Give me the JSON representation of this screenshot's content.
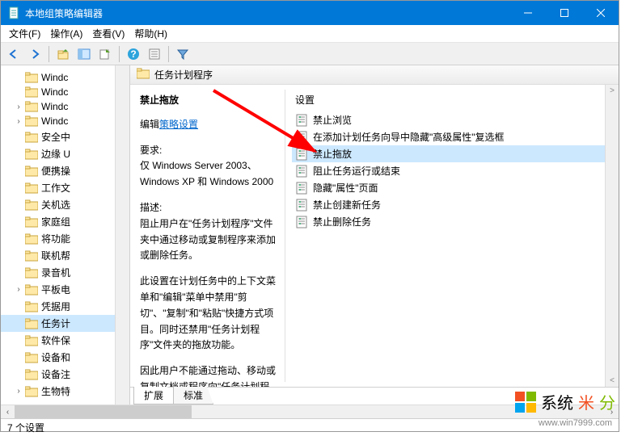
{
  "window": {
    "title": "本地组策略编辑器"
  },
  "menubar": {
    "file": "文件(F)",
    "action": "操作(A)",
    "view": "查看(V)",
    "help": "帮助(H)"
  },
  "tree": {
    "items": [
      {
        "label": "Windc",
        "expander": ""
      },
      {
        "label": "Windc",
        "expander": ""
      },
      {
        "label": "Windc",
        "expander": "›"
      },
      {
        "label": "Windc",
        "expander": "›"
      },
      {
        "label": "安全中",
        "expander": ""
      },
      {
        "label": "边缘 U",
        "expander": ""
      },
      {
        "label": "便携操",
        "expander": ""
      },
      {
        "label": "工作文",
        "expander": ""
      },
      {
        "label": "关机选",
        "expander": ""
      },
      {
        "label": "家庭组",
        "expander": ""
      },
      {
        "label": "将功能",
        "expander": ""
      },
      {
        "label": "联机帮",
        "expander": ""
      },
      {
        "label": "录音机",
        "expander": ""
      },
      {
        "label": "平板电",
        "expander": "›"
      },
      {
        "label": "凭据用",
        "expander": ""
      },
      {
        "label": "任务计",
        "expander": "",
        "selected": true
      },
      {
        "label": "软件保",
        "expander": ""
      },
      {
        "label": "设备和",
        "expander": ""
      },
      {
        "label": "设备注",
        "expander": ""
      },
      {
        "label": "生物特",
        "expander": "›"
      }
    ]
  },
  "content_header": {
    "title": "任务计划程序"
  },
  "detail": {
    "title": "禁止拖放",
    "edit_prefix": "编辑",
    "edit_link": "策略设置",
    "req_label": "要求:",
    "req_text": "仅 Windows Server 2003、Windows XP 和 Windows 2000",
    "desc_label": "描述:",
    "p1": "阻止用户在\"任务计划程序\"文件夹中通过移动或复制程序来添加或删除任务。",
    "p2": "此设置在计划任务中的上下文菜单和\"编辑\"菜单中禁用\"剪切\"、\"复制\"和\"粘贴\"快捷方式项目。同时还禁用\"任务计划程序\"文件夹的拖放功能。",
    "p3": "因此用户不能通过拖动、移动或复制文档或程序向\"任务计划程序\"文"
  },
  "settings": {
    "header": "设置",
    "items": [
      "禁止浏览",
      "在添加计划任务向导中隐藏\"高级属性\"复选框",
      "禁止拖放",
      "阻止任务运行或结束",
      "隐藏\"属性\"页面",
      "禁止创建新任务",
      "禁止删除任务"
    ],
    "selected_index": 2
  },
  "tabs": {
    "extended": "扩展",
    "standard": "标准"
  },
  "status": {
    "text": "7 个设置"
  },
  "watermark": {
    "brand_a": "系统",
    "brand_b": "米",
    "brand_c": "分",
    "url": "www.win7999.com"
  }
}
